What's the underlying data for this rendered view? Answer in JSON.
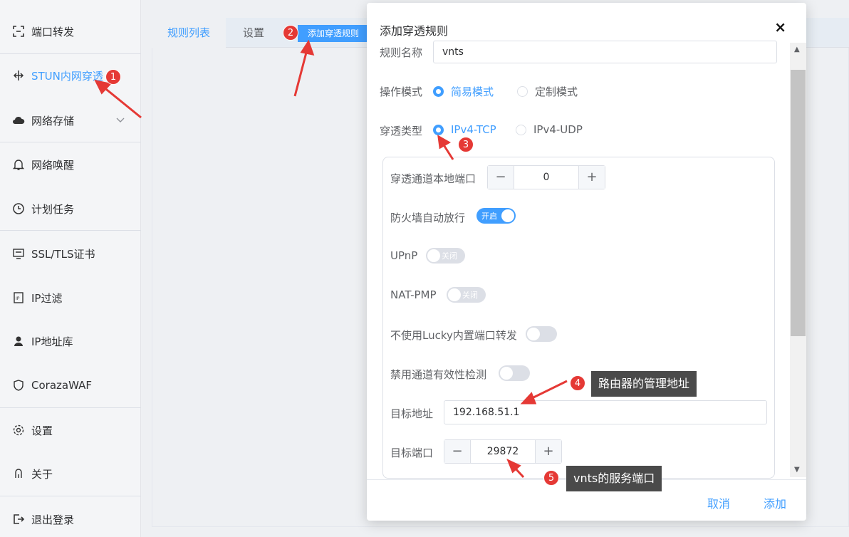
{
  "sidebar": {
    "items": [
      {
        "label": "端口转发",
        "icon": "port-forward-icon"
      },
      {
        "label": "STUN内网穿透",
        "icon": "stun-icon"
      },
      {
        "label": "网络存储",
        "icon": "cloud-icon"
      },
      {
        "label": "网络唤醒",
        "icon": "bell-icon"
      },
      {
        "label": "计划任务",
        "icon": "clock-icon"
      },
      {
        "label": "SSL/TLS证书",
        "icon": "certificate-icon"
      },
      {
        "label": "IP过滤",
        "icon": "ip-filter-icon"
      },
      {
        "label": "IP地址库",
        "icon": "user-icon"
      },
      {
        "label": "CorazaWAF",
        "icon": "shield-icon"
      },
      {
        "label": "设置",
        "icon": "gear-icon"
      },
      {
        "label": "关于",
        "icon": "about-icon"
      },
      {
        "label": "退出登录",
        "icon": "logout-icon"
      }
    ]
  },
  "tabs": {
    "rules_list": "规则列表",
    "settings": "设置",
    "add_rule": "添加穿透规则"
  },
  "modal": {
    "title": "添加穿透规则",
    "close": "×",
    "rule_name_label": "规则名称",
    "rule_name_value": "vnts",
    "op_mode_label": "操作模式",
    "op_mode_options": [
      "简易模式",
      "定制模式"
    ],
    "op_mode_selected": "简易模式",
    "type_label": "穿透类型",
    "type_options": [
      "IPv4-TCP",
      "IPv4-UDP"
    ],
    "type_selected": "IPv4-TCP",
    "local_port_label": "穿透通道本地端口",
    "local_port_value": "0",
    "firewall_label": "防火墙自动放行",
    "firewall_state": "开启",
    "upnp_label": "UPnP",
    "upnp_state": "关闭",
    "natpmp_label": "NAT-PMP",
    "natpmp_state": "关闭",
    "no_lucky_label": "不使用Lucky内置端口转发",
    "disable_check_label": "禁用通道有效性检测",
    "target_addr_label": "目标地址",
    "target_addr_value": "192.168.51.1",
    "target_port_label": "目标端口",
    "target_port_value": "29872",
    "cancel": "取消",
    "add": "添加"
  },
  "annotations": {
    "badges": [
      "1",
      "2",
      "3",
      "4",
      "5"
    ],
    "callout4": "路由器的管理地址",
    "callout5": "vnts的服务端口"
  },
  "colors": {
    "accent": "#409eff",
    "annotation": "#e53935"
  }
}
